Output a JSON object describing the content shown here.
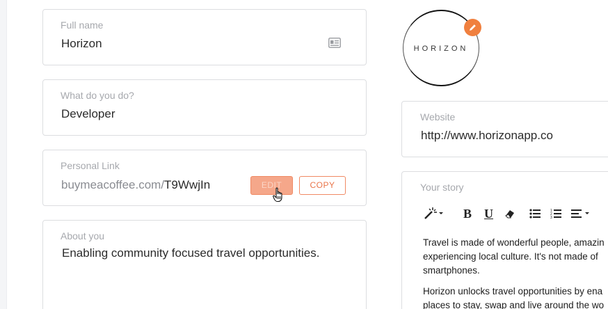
{
  "profile": {
    "full_name": {
      "label": "Full name",
      "value": "Horizon",
      "icon": "id-card-icon"
    },
    "what_do_you_do": {
      "label": "What do you do?",
      "value": "Developer"
    },
    "personal_link": {
      "label": "Personal Link",
      "prefix": "buymeacoffee.com/",
      "slug": "T9WwjIn",
      "edit_label": "EDIT",
      "copy_label": "COPY"
    },
    "about_you": {
      "label": "About you",
      "value": "Enabling community focused travel opportunities."
    }
  },
  "logo": {
    "text": "HORIZON",
    "badge_icon": "pencil-icon"
  },
  "website": {
    "label": "Website",
    "value": "http://www.horizonapp.co"
  },
  "story": {
    "label": "Your story",
    "toolbar": [
      "magic-wand-icon",
      "bold-icon",
      "underline-icon",
      "eraser-icon",
      "bullet-list-icon",
      "numbered-list-icon",
      "align-icon"
    ],
    "bold": "B",
    "underline": "U",
    "lines_p1": [
      "Travel is made of wonderful people, amazin",
      "experiencing local culture. It's not made of",
      "smartphones."
    ],
    "lines_p2": [
      "Horizon unlocks travel opportunities by ena",
      "places to stay, swap and live around the wo"
    ]
  },
  "colors": {
    "accent": "#f0803f",
    "border": "#dcdde0",
    "label": "#a6a8ad"
  }
}
